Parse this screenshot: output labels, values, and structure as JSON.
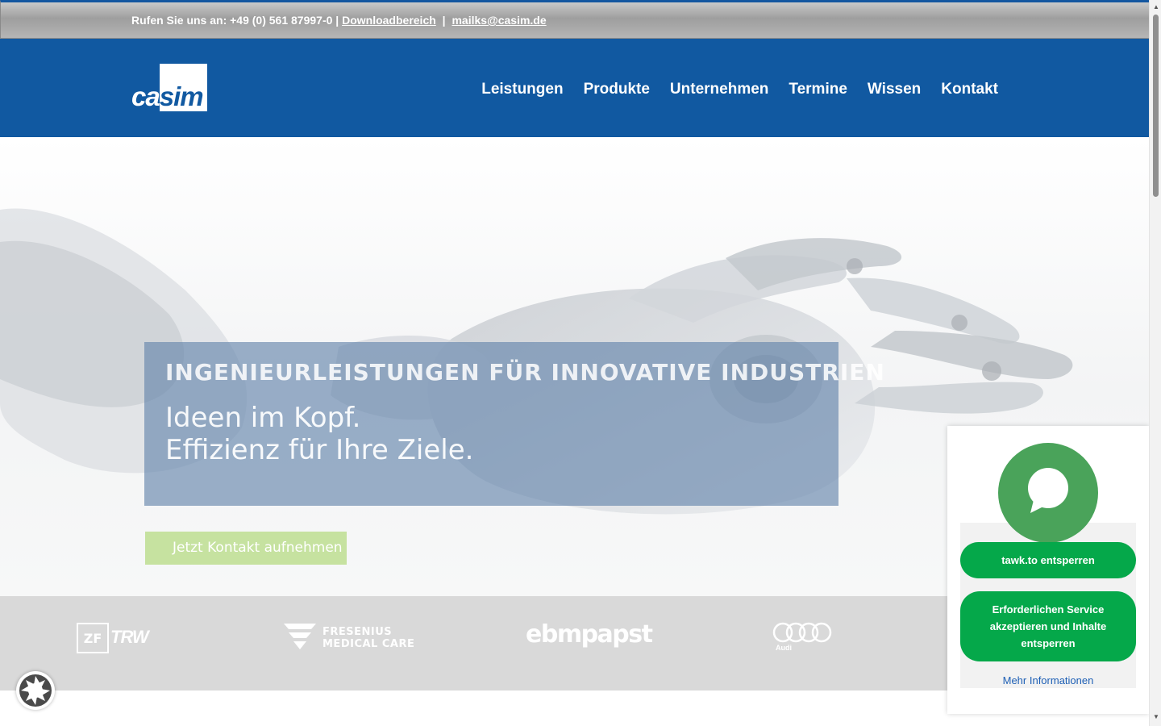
{
  "topbar": {
    "phone_text": "Rufen Sie uns an: +49 (0) 561 87997-0 |",
    "download_link": "Downloadbereich",
    "separator": "|",
    "email_link": "mailks@casim.de"
  },
  "header": {
    "logo_text_left": "ca",
    "logo_text_right": "sim",
    "nav": [
      "Leistungen",
      "Produkte",
      "Unternehmen",
      "Termine",
      "Wissen",
      "Kontakt"
    ]
  },
  "hero": {
    "kicker": "INGENIEURLEISTUNGEN FÜR INNOVATIVE INDUSTRIEN",
    "line1": "Ideen im Kopf.",
    "line2": "Effizienz für Ihre Ziele.",
    "cta": "Jetzt Kontakt aufnehmen"
  },
  "clients": {
    "trw": "TRW",
    "zf": "ZF",
    "fresenius_line1": "FRESENIUS",
    "fresenius_line2": "MEDICAL CARE",
    "ebm": "ebmpapst",
    "audi": "Audi"
  },
  "consent": {
    "unlock_button": "tawk.to entsperren",
    "accept_button": "Erforderlichen Service akzeptieren und Inhalte entsperren",
    "more_info": "Mehr Informationen"
  },
  "colors": {
    "brand_blue": "#1159a1",
    "consent_green": "#05a84a",
    "chat_green": "#4aa35a",
    "cta_green": "#c6e2a0"
  }
}
